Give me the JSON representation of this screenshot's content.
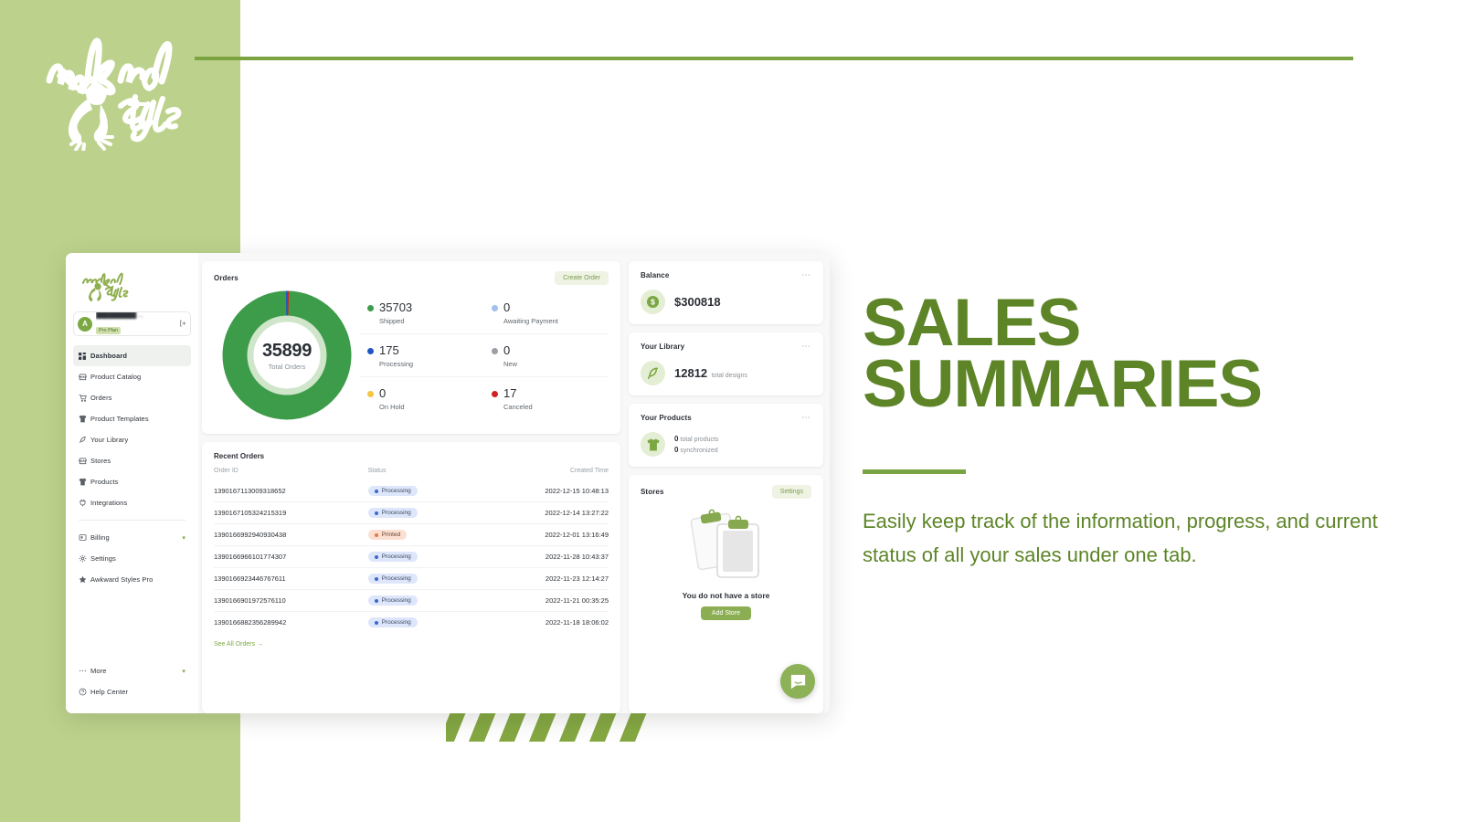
{
  "brand": {
    "name_line1": "awkward",
    "name_line2": "Styles",
    "logo_icon": "frog-logo-icon"
  },
  "promo": {
    "title_line1": "SALES",
    "title_line2": "SUMMARIES",
    "body": "Easily keep track of the information, progress, and current status of all your sales under one tab."
  },
  "app": {
    "sidebar": {
      "account": {
        "avatar_initial": "A",
        "name": "██████████ …",
        "plan_badge": "Pro Plan",
        "logout_icon": "logout-icon"
      },
      "items": [
        {
          "label": "Dashboard",
          "icon": "grid-icon",
          "active": true
        },
        {
          "label": "Product Catalog",
          "icon": "store-icon",
          "active": false
        },
        {
          "label": "Orders",
          "icon": "cart-icon",
          "active": false
        },
        {
          "label": "Product Templates",
          "icon": "shirt-icon",
          "active": false
        },
        {
          "label": "Your Library",
          "icon": "feather-icon",
          "active": false
        },
        {
          "label": "Stores",
          "icon": "store-icon",
          "active": false
        },
        {
          "label": "Products",
          "icon": "shirt-icon",
          "active": false
        },
        {
          "label": "Integrations",
          "icon": "plug-icon",
          "active": false
        }
      ],
      "group2": [
        {
          "label": "Billing",
          "icon": "credit-card-icon",
          "chevron": "▾"
        },
        {
          "label": "Settings",
          "icon": "gear-icon",
          "chevron": ""
        },
        {
          "label": "Awkward Styles Pro",
          "icon": "star-icon",
          "chevron": ""
        }
      ],
      "bottom": [
        {
          "label": "More",
          "icon": "ellipsis-icon",
          "chevron": "▾"
        },
        {
          "label": "Help Center",
          "icon": "help-circle-icon",
          "chevron": ""
        }
      ]
    },
    "orders_card": {
      "title": "Orders",
      "create_button": "Create Order",
      "total_value": "35899",
      "total_label": "Total Orders"
    },
    "recent_orders": {
      "title": "Recent Orders",
      "columns": [
        "Order ID",
        "Status",
        "Created Time"
      ],
      "rows": [
        {
          "id": "1390167113009318652",
          "status": "Processing",
          "status_kind": "processing",
          "time": "2022-12-15 10:48:13"
        },
        {
          "id": "1390167105324215319",
          "status": "Processing",
          "status_kind": "processing",
          "time": "2022-12-14 13:27:22"
        },
        {
          "id": "1390166992940930438",
          "status": "Printed",
          "status_kind": "printed",
          "time": "2022-12-01 13:16:49"
        },
        {
          "id": "1390166966101774307",
          "status": "Processing",
          "status_kind": "processing",
          "time": "2022-11-28 10:43:37"
        },
        {
          "id": "1390166923446767611",
          "status": "Processing",
          "status_kind": "processing",
          "time": "2022-11-23 12:14:27"
        },
        {
          "id": "1390166901972576110",
          "status": "Processing",
          "status_kind": "processing",
          "time": "2022-11-21 00:35:25"
        },
        {
          "id": "1390166882356289942",
          "status": "Processing",
          "status_kind": "processing",
          "time": "2022-11-18 18:06:02"
        }
      ],
      "see_all": "See All Orders  →"
    },
    "balance_card": {
      "title": "Balance",
      "value": "$300818",
      "icon": "dollar-coin-icon",
      "menu_icon": "more-icon"
    },
    "library_card": {
      "title": "Your Library",
      "value": "12812",
      "unit": "total designs",
      "icon": "feather-icon",
      "menu_icon": "more-icon"
    },
    "products_card": {
      "title": "Your Products",
      "line1_value": "0",
      "line1_label": "total products",
      "line2_value": "0",
      "line2_label": "synchronized",
      "icon": "shirt-icon",
      "menu_icon": "more-icon"
    },
    "stores_card": {
      "title": "Stores",
      "settings_button": "Settings",
      "empty_message": "You do not have a store",
      "add_button": "Add Store",
      "illustration": "clipboards-icon"
    },
    "chat_widget": {
      "icon": "chat-bubble-icon"
    }
  },
  "chart_data": {
    "type": "pie",
    "title": "Orders",
    "center_value": 35899,
    "center_label": "Total Orders",
    "categories": [
      "Shipped",
      "Processing",
      "On Hold",
      "Awaiting Payment",
      "New",
      "Canceled"
    ],
    "values": [
      35703,
      175,
      0,
      0,
      0,
      17
    ],
    "colors": [
      "#3d9c49",
      "#2255c4",
      "#f5c441",
      "#9fc0f0",
      "#9aa0a6",
      "#cf2222"
    ],
    "legend_position": "right",
    "grid": false
  },
  "colors": {
    "brand_green": "#bcd28c",
    "accent_green": "#7ba440",
    "promo_green": "#5d8527",
    "shipped": "#3d9c49",
    "processing": "#2255c4",
    "on_hold": "#f5c441",
    "awaiting_payment": "#9fc0f0",
    "new": "#9aa0a6",
    "canceled": "#cf2222"
  }
}
